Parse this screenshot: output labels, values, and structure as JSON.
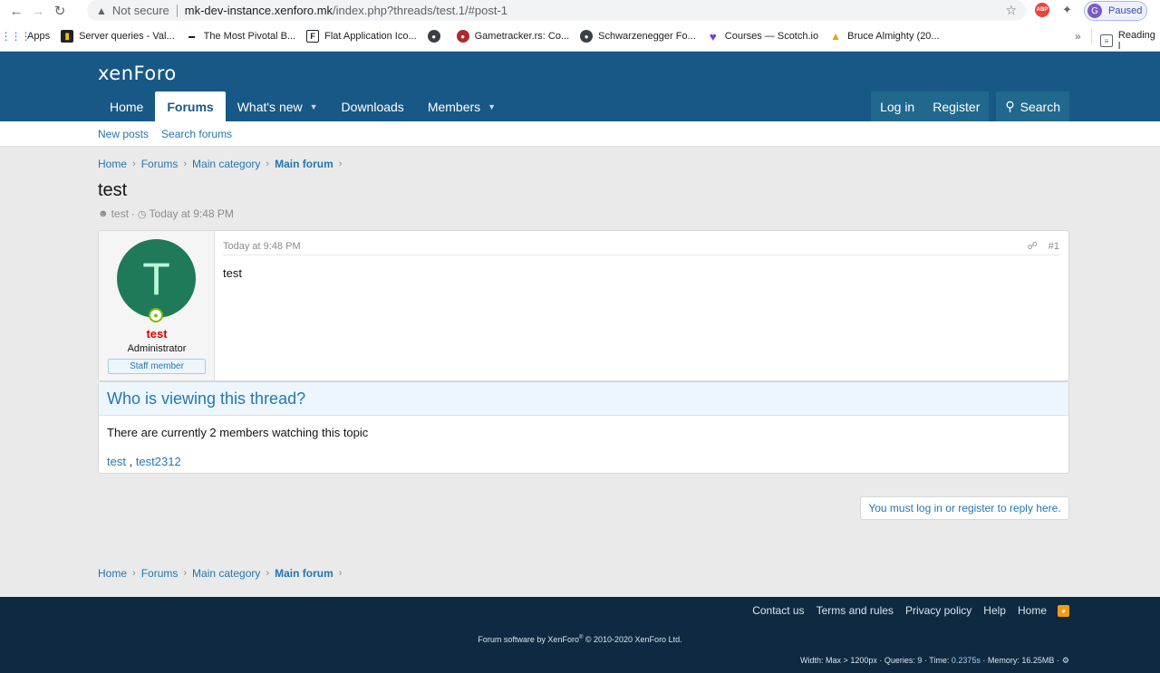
{
  "browser": {
    "not_secure": "Not secure",
    "url_host": "mk-dev-instance.xenforo.mk",
    "url_path": "/index.php?threads/test.1/#post-1",
    "profile_initial": "G",
    "profile_label": "Paused",
    "abp_label": "ABP",
    "bookmarks": [
      {
        "label": "Apps",
        "icon": "apps-grid-icon"
      },
      {
        "label": "Server queries - Val...",
        "icon": "bookmark-favicon"
      },
      {
        "label": "The Most Pivotal B...",
        "icon": "bookmark-favicon"
      },
      {
        "label": "Flat Application Ico...",
        "icon": "bookmark-favicon"
      },
      {
        "label": "",
        "icon": "globe-icon"
      },
      {
        "label": "Gametracker.rs: Co...",
        "icon": "bookmark-favicon"
      },
      {
        "label": "Schwarzenegger Fo...",
        "icon": "globe-icon"
      },
      {
        "label": "Courses — Scotch.io",
        "icon": "bookmark-favicon"
      },
      {
        "label": "Bruce Almighty (20...",
        "icon": "bookmark-favicon"
      }
    ],
    "reading_list": "Reading l"
  },
  "header": {
    "logo_a": "xen",
    "logo_b": "Foro",
    "tabs": [
      {
        "label": "Home",
        "active": false,
        "dropdown": false
      },
      {
        "label": "Forums",
        "active": true,
        "dropdown": false
      },
      {
        "label": "What's new",
        "active": false,
        "dropdown": true
      },
      {
        "label": "Downloads",
        "active": false,
        "dropdown": false
      },
      {
        "label": "Members",
        "active": false,
        "dropdown": true
      }
    ],
    "login": "Log in",
    "register": "Register",
    "search": "Search"
  },
  "subnav": {
    "new_posts": "New posts",
    "search_forums": "Search forums"
  },
  "breadcrumb": [
    "Home",
    "Forums",
    "Main category"
  ],
  "breadcrumb_current": "Main forum",
  "thread": {
    "title": "test",
    "author": "test",
    "sep": "·",
    "time": "Today at 9:48 PM"
  },
  "post": {
    "avatar_letter": "T",
    "username": "test",
    "user_title": "Administrator",
    "staff_badge": "Staff member",
    "date": "Today at 9:48 PM",
    "number": "#1",
    "body": "test"
  },
  "viewers": {
    "heading": "Who is viewing this thread?",
    "text": "There are currently 2 members watching this topic",
    "members": [
      "test",
      "test2312"
    ],
    "separator": " , "
  },
  "reply_notice": "You must log in or register to reply here.",
  "footer": {
    "links": [
      "Contact us",
      "Terms and rules",
      "Privacy policy",
      "Help",
      "Home"
    ],
    "copyright_a": "Forum software by XenForo",
    "copyright_reg": "®",
    "copyright_b": " © 2010-2020 XenForo Ltd.",
    "debug_a": "Width: Max > 1200px · Queries: 9 · Time: ",
    "debug_time": "0.2375s",
    "debug_b": " · Memory: 16.25MB ·"
  },
  "colors": {
    "header_bg": "#185886",
    "link": "#2577b1",
    "footer_bg": "#0f2a40",
    "username": "#e30000",
    "avatar_bg": "#1f7a5a"
  }
}
